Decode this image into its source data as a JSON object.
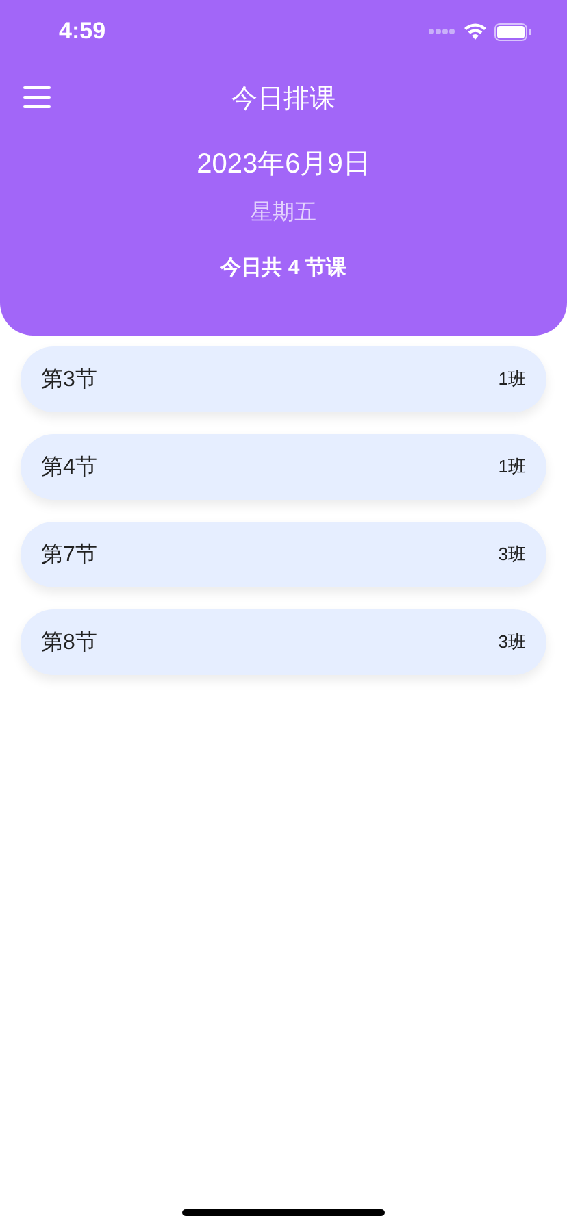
{
  "status_bar": {
    "time": "4:59"
  },
  "header": {
    "title": "今日排课",
    "date": "2023年6月9日",
    "weekday": "星期五",
    "summary": "今日共 **4** 节课"
  },
  "lessons": [
    {
      "period": "第3节",
      "class": "1班"
    },
    {
      "period": "第4节",
      "class": "1班"
    },
    {
      "period": "第7节",
      "class": "3班"
    },
    {
      "period": "第8节",
      "class": "3班"
    }
  ]
}
